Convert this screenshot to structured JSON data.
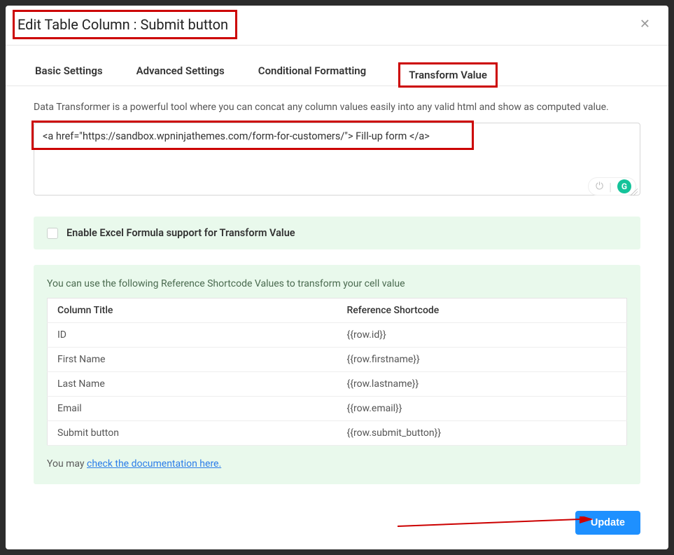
{
  "header": {
    "title": "Edit Table Column : Submit button",
    "close_glyph": "✕"
  },
  "tabs": {
    "items": [
      {
        "label": "Basic Settings"
      },
      {
        "label": "Advanced Settings"
      },
      {
        "label": "Conditional Formatting"
      },
      {
        "label": "Transform Value"
      }
    ],
    "active_index": 3
  },
  "intro": "Data Transformer is a powerful tool where you can concat any column values easily into any valid html and show as computed value.",
  "editor": {
    "value": "<a href=\"https://sandbox.wpninjathemes.com/form-for-customers/\"> Fill-up form </a>"
  },
  "grammarly": {
    "letter": "G"
  },
  "excel": {
    "label": "Enable Excel Formula support for Transform Value",
    "checked": false
  },
  "reference": {
    "intro": "You can use the following Reference Shortcode Values to transform your cell value",
    "columns": {
      "title": "Column Title",
      "shortcode": "Reference Shortcode"
    },
    "rows": [
      {
        "title": "ID",
        "shortcode": "{{row.id}}"
      },
      {
        "title": "First Name",
        "shortcode": "{{row.firstname}}"
      },
      {
        "title": "Last Name",
        "shortcode": "{{row.lastname}}"
      },
      {
        "title": "Email",
        "shortcode": "{{row.email}}"
      },
      {
        "title": "Submit button",
        "shortcode": "{{row.submit_button}}"
      }
    ],
    "doc_prefix": "You may ",
    "doc_link": "check the documentation here."
  },
  "footer": {
    "update_label": "Update"
  }
}
